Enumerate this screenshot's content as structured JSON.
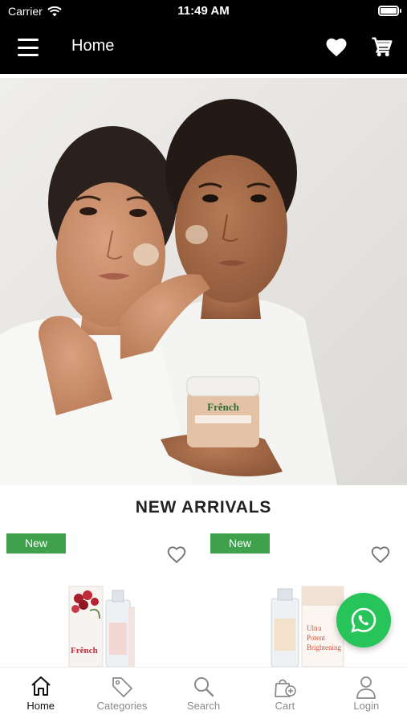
{
  "status_bar": {
    "carrier": "Carrier",
    "time": "11:49 AM"
  },
  "nav": {
    "title": "Home",
    "menu_icon": "hamburger-menu-icon",
    "favorites_icon": "heart-icon",
    "cart_icon": "cart-icon"
  },
  "hero": {
    "brand_on_jar": "Frênch"
  },
  "section": {
    "title": "NEW ARRIVALS"
  },
  "products": [
    {
      "badge": "New",
      "brand": "Frênch"
    },
    {
      "badge": "New",
      "box_text": [
        "Ultra",
        "Potent",
        "Brightening"
      ]
    }
  ],
  "tabs": [
    {
      "label": "Home",
      "icon": "home-icon",
      "active": true
    },
    {
      "label": "Categories",
      "icon": "tag-icon",
      "active": false
    },
    {
      "label": "Search",
      "icon": "search-icon",
      "active": false
    },
    {
      "label": "Cart",
      "icon": "cart-add-icon",
      "active": false
    },
    {
      "label": "Login",
      "icon": "user-icon",
      "active": false
    }
  ],
  "colors": {
    "header": "#000000",
    "badge": "#3fa14b",
    "whatsapp": "#27c45a",
    "tab_active": "#111111",
    "tab_inactive": "#8a8a8a"
  }
}
